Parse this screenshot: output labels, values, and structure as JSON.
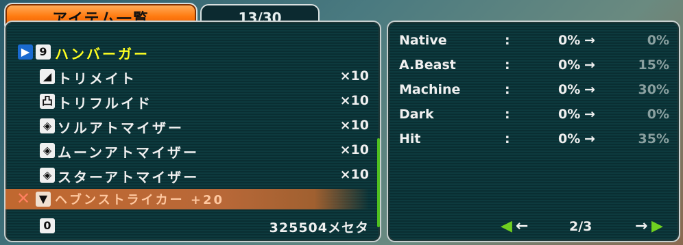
{
  "header": {
    "title": "アイテム一覧",
    "count": "13/30"
  },
  "items": [
    {
      "name": "ハンバーガー",
      "qty": "",
      "icon": "weapon-icon",
      "glyph": "9",
      "state": "selected"
    },
    {
      "name": "トリメイト",
      "qty": "×10",
      "icon": "mate-icon",
      "glyph": "◢",
      "state": ""
    },
    {
      "name": "トリフルイド",
      "qty": "×10",
      "icon": "fluid-icon",
      "glyph": "凸",
      "state": ""
    },
    {
      "name": "ソルアトマイザー",
      "qty": "×10",
      "icon": "atomizer-icon",
      "glyph": "◈",
      "state": ""
    },
    {
      "name": "ムーンアトマイザー",
      "qty": "×10",
      "icon": "atomizer-icon",
      "glyph": "◈",
      "state": ""
    },
    {
      "name": "スターアトマイザー",
      "qty": "×10",
      "icon": "atomizer-icon",
      "glyph": "◈",
      "state": ""
    },
    {
      "name": "ヘブンストライカー +20",
      "qty": "",
      "icon": "weapon-icon",
      "glyph": "▼",
      "state": "equipped"
    },
    {
      "name": "",
      "qty": "325504メセタ",
      "icon": "meseta-icon",
      "glyph": "0",
      "state": ""
    }
  ],
  "stats": [
    {
      "label": "Native",
      "colon": ":",
      "current": "0%",
      "arrow": "→",
      "next": "0%"
    },
    {
      "label": "A.Beast",
      "colon": ":",
      "current": "0%",
      "arrow": "→",
      "next": "15%"
    },
    {
      "label": "Machine",
      "colon": ":",
      "current": "0%",
      "arrow": "→",
      "next": "30%"
    },
    {
      "label": "Dark",
      "colon": ":",
      "current": "0%",
      "arrow": "→",
      "next": "0%"
    },
    {
      "label": "Hit",
      "colon": ":",
      "current": "0%",
      "arrow": "→",
      "next": "35%"
    }
  ],
  "pager": {
    "prev_arrow": "◀",
    "prev_arrow_white": "←",
    "page": "2/3",
    "next_arrow_white": "→",
    "next_arrow": "▶"
  },
  "colors": {
    "accent_orange": "#ff7a10",
    "selected_yellow": "#ffff20",
    "scroll_green": "#50c020",
    "panel_teal": "#0d3a3e"
  }
}
